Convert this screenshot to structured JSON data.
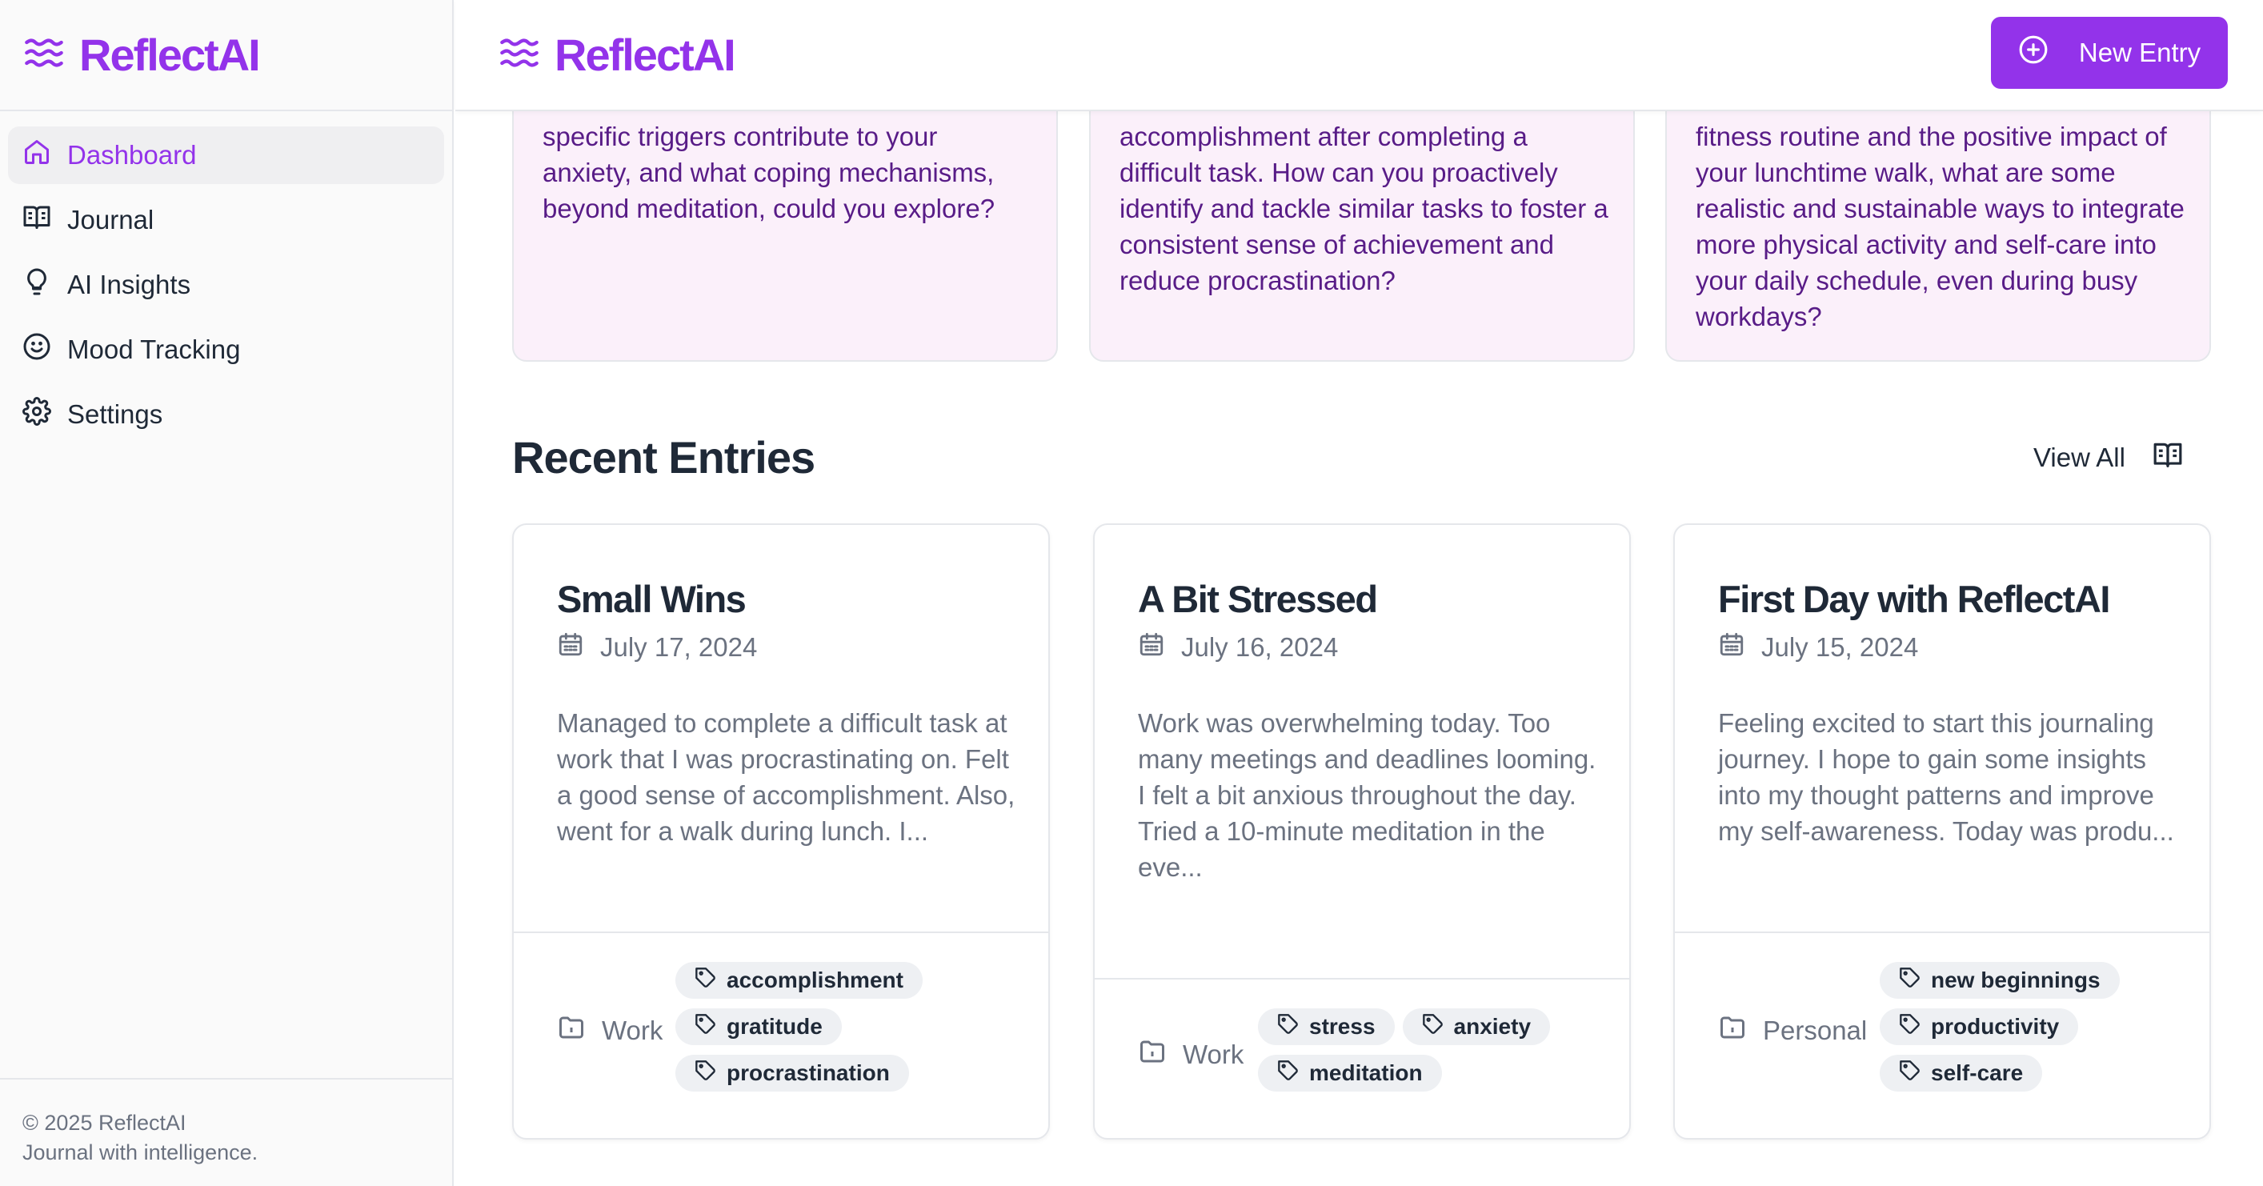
{
  "brand": {
    "name": "ReflectAI",
    "color": "#9333ea",
    "icon": "waves-icon"
  },
  "sidebar": {
    "items": [
      {
        "label": "Dashboard",
        "icon": "home-icon",
        "active": true
      },
      {
        "label": "Journal",
        "icon": "book-open-icon"
      },
      {
        "label": "AI Insights",
        "icon": "lightbulb-icon"
      },
      {
        "label": "Mood Tracking",
        "icon": "smile-icon"
      },
      {
        "label": "Settings",
        "icon": "gear-icon"
      }
    ],
    "footer": {
      "copyright": "© 2025 ReflectAI",
      "tagline": "Journal with intelligence."
    }
  },
  "header": {
    "new_entry_label": "New Entry",
    "new_entry_icon": "plus-circle-icon"
  },
  "insights": [
    {
      "text": "specific triggers contribute to your anxiety, and what coping mechanisms, beyond meditation, could you explore?"
    },
    {
      "text": "accomplishment after completing a difficult task. How can you proactively identify and tackle similar tasks to foster a consistent sense of achievement and reduce procrastination?"
    },
    {
      "text": "fitness routine and the positive impact of your lunchtime walk, what are some realistic and sustainable ways to integrate more physical activity and self-care into your daily schedule, even during busy workdays?"
    }
  ],
  "recent": {
    "title": "Recent Entries",
    "view_all_label": "View All",
    "entries": [
      {
        "title": "Small Wins",
        "date": "July 17, 2024",
        "excerpt": "Managed to complete a difficult task at work that I was procrastinating on. Felt a good sense of accomplishment. Also, went for a walk during lunch. I...",
        "category": "Work",
        "tags": [
          "accomplishment",
          "gratitude",
          "procrastination"
        ]
      },
      {
        "title": "A Bit Stressed",
        "date": "July 16, 2024",
        "excerpt": "Work was overwhelming today. Too many meetings and deadlines looming. I felt a bit anxious throughout the day. Tried a 10-minute meditation in the eve...",
        "category": "Work",
        "tags": [
          "stress",
          "anxiety",
          "meditation"
        ]
      },
      {
        "title": "First Day with ReflectAI",
        "date": "July 15, 2024",
        "excerpt": "Feeling excited to start this journaling journey. I hope to gain some insights into my thought patterns and improve my self-awareness. Today was produ...",
        "category": "Personal",
        "tags": [
          "new beginnings",
          "productivity",
          "self-care"
        ]
      }
    ]
  }
}
